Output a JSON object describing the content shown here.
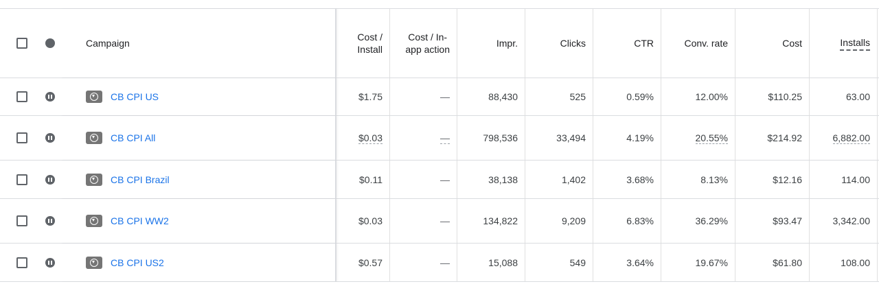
{
  "header": {
    "campaign": "Campaign",
    "cost_install": [
      "Cost /",
      "Install"
    ],
    "cost_inapp": [
      "Cost / In-",
      "app action"
    ],
    "impr": "Impr.",
    "clicks": "Clicks",
    "ctr": "CTR",
    "conv_rate": "Conv. rate",
    "cost": "Cost",
    "installs": "Installs"
  },
  "rows": [
    {
      "name": "CB CPI US",
      "cost_install": "$1.75",
      "cost_inapp": "—",
      "impr": "88,430",
      "clicks": "525",
      "ctr": "0.59%",
      "conv_rate": "12.00%",
      "cost": "$110.25",
      "installs": "63.00"
    },
    {
      "name": "CB CPI All",
      "cost_install": "$0.03",
      "cost_inapp": "—",
      "impr": "798,536",
      "clicks": "33,494",
      "ctr": "4.19%",
      "conv_rate": "20.55%",
      "cost": "$214.92",
      "installs": "6,882.00"
    },
    {
      "name": "CB CPI Brazil",
      "cost_install": "$0.11",
      "cost_inapp": "—",
      "impr": "38,138",
      "clicks": "1,402",
      "ctr": "3.68%",
      "conv_rate": "8.13%",
      "cost": "$12.16",
      "installs": "114.00"
    },
    {
      "name": "CB CPI WW2",
      "cost_install": "$0.03",
      "cost_inapp": "—",
      "impr": "134,822",
      "clicks": "9,209",
      "ctr": "6.83%",
      "conv_rate": "36.29%",
      "cost": "$93.47",
      "installs": "3,342.00"
    },
    {
      "name": "CB CPI US2",
      "cost_install": "$0.57",
      "cost_inapp": "—",
      "impr": "15,088",
      "clicks": "549",
      "ctr": "3.64%",
      "conv_rate": "19.67%",
      "cost": "$61.80",
      "installs": "108.00"
    }
  ],
  "colors": {
    "link": "#1a73e8",
    "icon": "#5f6368",
    "border": "#dadce0"
  }
}
